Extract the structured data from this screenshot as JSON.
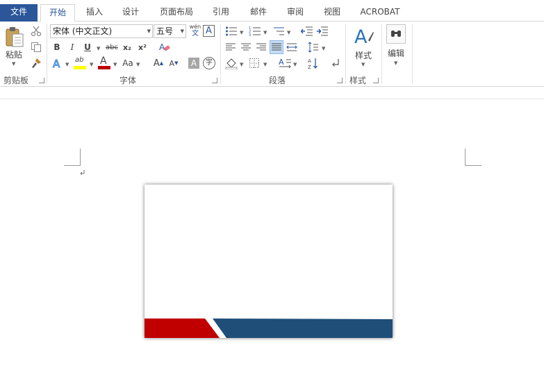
{
  "tabs": [
    {
      "label": "文件"
    },
    {
      "label": "开始"
    },
    {
      "label": "插入"
    },
    {
      "label": "设计"
    },
    {
      "label": "页面布局"
    },
    {
      "label": "引用"
    },
    {
      "label": "邮件"
    },
    {
      "label": "审阅"
    },
    {
      "label": "视图"
    },
    {
      "label": "ACROBAT"
    }
  ],
  "clipboard": {
    "paste_label": "粘贴",
    "group_label": "剪贴板"
  },
  "font": {
    "font_name": "宋体 (中文正文)",
    "font_size": "五号",
    "phonetic_top": "wén",
    "phonetic_bottom": "文",
    "bold": "B",
    "italic": "I",
    "underline": "U",
    "strike": "abc",
    "subscript": "x₂",
    "superscript": "x²",
    "highlight": "ab",
    "font_color": "A",
    "change_case": "Aa",
    "grow": "A",
    "shrink": "A",
    "char_shading": "A",
    "enclose": "字",
    "group_label": "字体"
  },
  "paragraph": {
    "group_label": "段落"
  },
  "styles": {
    "label": "样式",
    "group_label": "样式"
  },
  "editing": {
    "label": "编辑"
  },
  "colors": {
    "accent": "#2b579a",
    "highlight": "#ffff00",
    "font_color": "#c00000",
    "card_red": "#c00000",
    "card_blue": "#1f4e79"
  }
}
